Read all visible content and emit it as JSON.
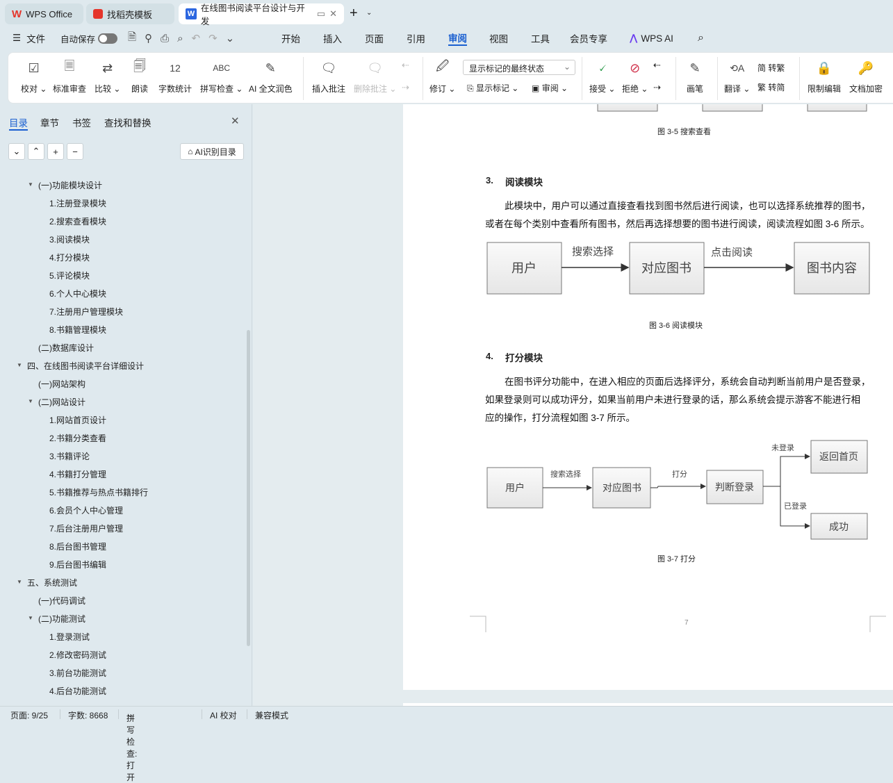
{
  "tabs": [
    {
      "label": "WPS Office",
      "icon": "wps-logo-icon"
    },
    {
      "label": "找稻壳模板",
      "icon": "docer-icon"
    },
    {
      "label": "在线图书阅读平台设计与开发",
      "icon": "word-doc-icon",
      "active": true
    }
  ],
  "menu": {
    "file": "文件",
    "autosave": "自动保存",
    "items": [
      "开始",
      "插入",
      "页面",
      "引用",
      "审阅",
      "视图",
      "工具",
      "会员专享"
    ],
    "active": "审阅",
    "wps_ai": "WPS AI"
  },
  "ribbon": {
    "proof": "校对",
    "std_review": "标准审查",
    "compare": "比较",
    "read_aloud": "朗读",
    "word_count": "字数统计",
    "spell_check": "拼写检查",
    "ai_polish": "AI 全文润色",
    "insert_comment": "插入批注",
    "delete_comment": "删除批注",
    "track": "修订",
    "markup_select": "显示标记的最终状态",
    "show_markup": "显示标记",
    "review_pane": "审阅",
    "accept": "接受",
    "reject": "拒绝",
    "pen": "画笔",
    "translate": "翻译",
    "to_trad": "转繁",
    "to_simp": "转简",
    "restrict": "限制编辑",
    "encrypt": "文档加密"
  },
  "sidebar": {
    "tabs": [
      "目录",
      "章节",
      "书签",
      "查找和替换"
    ],
    "active_tab": "目录",
    "ai_toc": "AI识别目录",
    "items": [
      {
        "label": "(一)功能模块设计",
        "level": 2,
        "expanded": true
      },
      {
        "label": "1.注册登录模块",
        "level": 3
      },
      {
        "label": "2.搜索查看模块",
        "level": 3
      },
      {
        "label": "3.阅读模块",
        "level": 3
      },
      {
        "label": "4.打分模块",
        "level": 3
      },
      {
        "label": "5.评论模块",
        "level": 3
      },
      {
        "label": "6.个人中心模块",
        "level": 3
      },
      {
        "label": "7.注册用户管理模块",
        "level": 3
      },
      {
        "label": "8.书籍管理模块",
        "level": 3
      },
      {
        "label": "(二)数据库设计",
        "level": 2
      },
      {
        "label": "四、在线图书阅读平台详细设计",
        "level": 1,
        "expanded": true
      },
      {
        "label": "(一)网站架构",
        "level": 2
      },
      {
        "label": "(二)网站设计",
        "level": 2,
        "expanded": true
      },
      {
        "label": "1.网站首页设计",
        "level": 3
      },
      {
        "label": "2.书籍分类查看",
        "level": 3
      },
      {
        "label": "3.书籍评论",
        "level": 3
      },
      {
        "label": "4.书籍打分管理",
        "level": 3
      },
      {
        "label": "5.书籍推荐与热点书籍排行",
        "level": 3
      },
      {
        "label": "6.会员个人中心管理",
        "level": 3
      },
      {
        "label": "7.后台注册用户管理",
        "level": 3
      },
      {
        "label": "8.后台图书管理",
        "level": 3
      },
      {
        "label": "9.后台图书编辑",
        "level": 3
      },
      {
        "label": "五、系统测试",
        "level": 1,
        "expanded": true
      },
      {
        "label": "(一)代码调试",
        "level": 2
      },
      {
        "label": "(二)功能测试",
        "level": 2,
        "expanded": true
      },
      {
        "label": "1.登录测试",
        "level": 3
      },
      {
        "label": "2.修改密码测试",
        "level": 3
      },
      {
        "label": "3.前台功能测试",
        "level": 3
      },
      {
        "label": "4.后台功能测试",
        "level": 3
      }
    ]
  },
  "document": {
    "fig35_caption": "图 3-5 搜索查看",
    "sec3_num": "3.",
    "sec3_title": "阅读模块",
    "sec3_p1": "此模块中，用户可以通过直接查看找到图书然后进行阅读，也可以选择系统推荐的图书，",
    "sec3_p2": "或者在每个类别中查看所有图书，然后再选择想要的图书进行阅读，阅读流程如图 3-6 所示。",
    "fig36": {
      "user": "用户",
      "book": "对应图书",
      "content": "图书内容",
      "search": "搜索选择",
      "click": "点击阅读"
    },
    "fig36_caption": "图 3-6 阅读模块",
    "sec4_num": "4.",
    "sec4_title": "打分模块",
    "sec4_p1": "在图书评分功能中，在进入相应的页面后选择评分，系统会自动判断当前用户是否登录，",
    "sec4_p2": "如果登录则可以成功评分，如果当前用户未进行登录的话，那么系统会提示游客不能进行相",
    "sec4_p3": "应的操作，打分流程如图 3-7 所示。",
    "fig37": {
      "user": "用户",
      "book": "对应图书",
      "judge": "判断登录",
      "home": "返回首页",
      "success": "成功",
      "search": "搜索选择",
      "rate": "打分",
      "not_logged": "未登录",
      "logged": "已登录"
    },
    "fig37_caption": "图 3-7 打分",
    "page_number": "7"
  },
  "status": {
    "page": "页面: 9/25",
    "words": "字数: 8668",
    "spell": "拼写检查: 打开",
    "ai": "AI 校对",
    "compat": "兼容模式"
  },
  "colors": {
    "accent": "#1a5fd0",
    "wps_red": "#e5352b",
    "word_blue": "#2b66e0"
  }
}
